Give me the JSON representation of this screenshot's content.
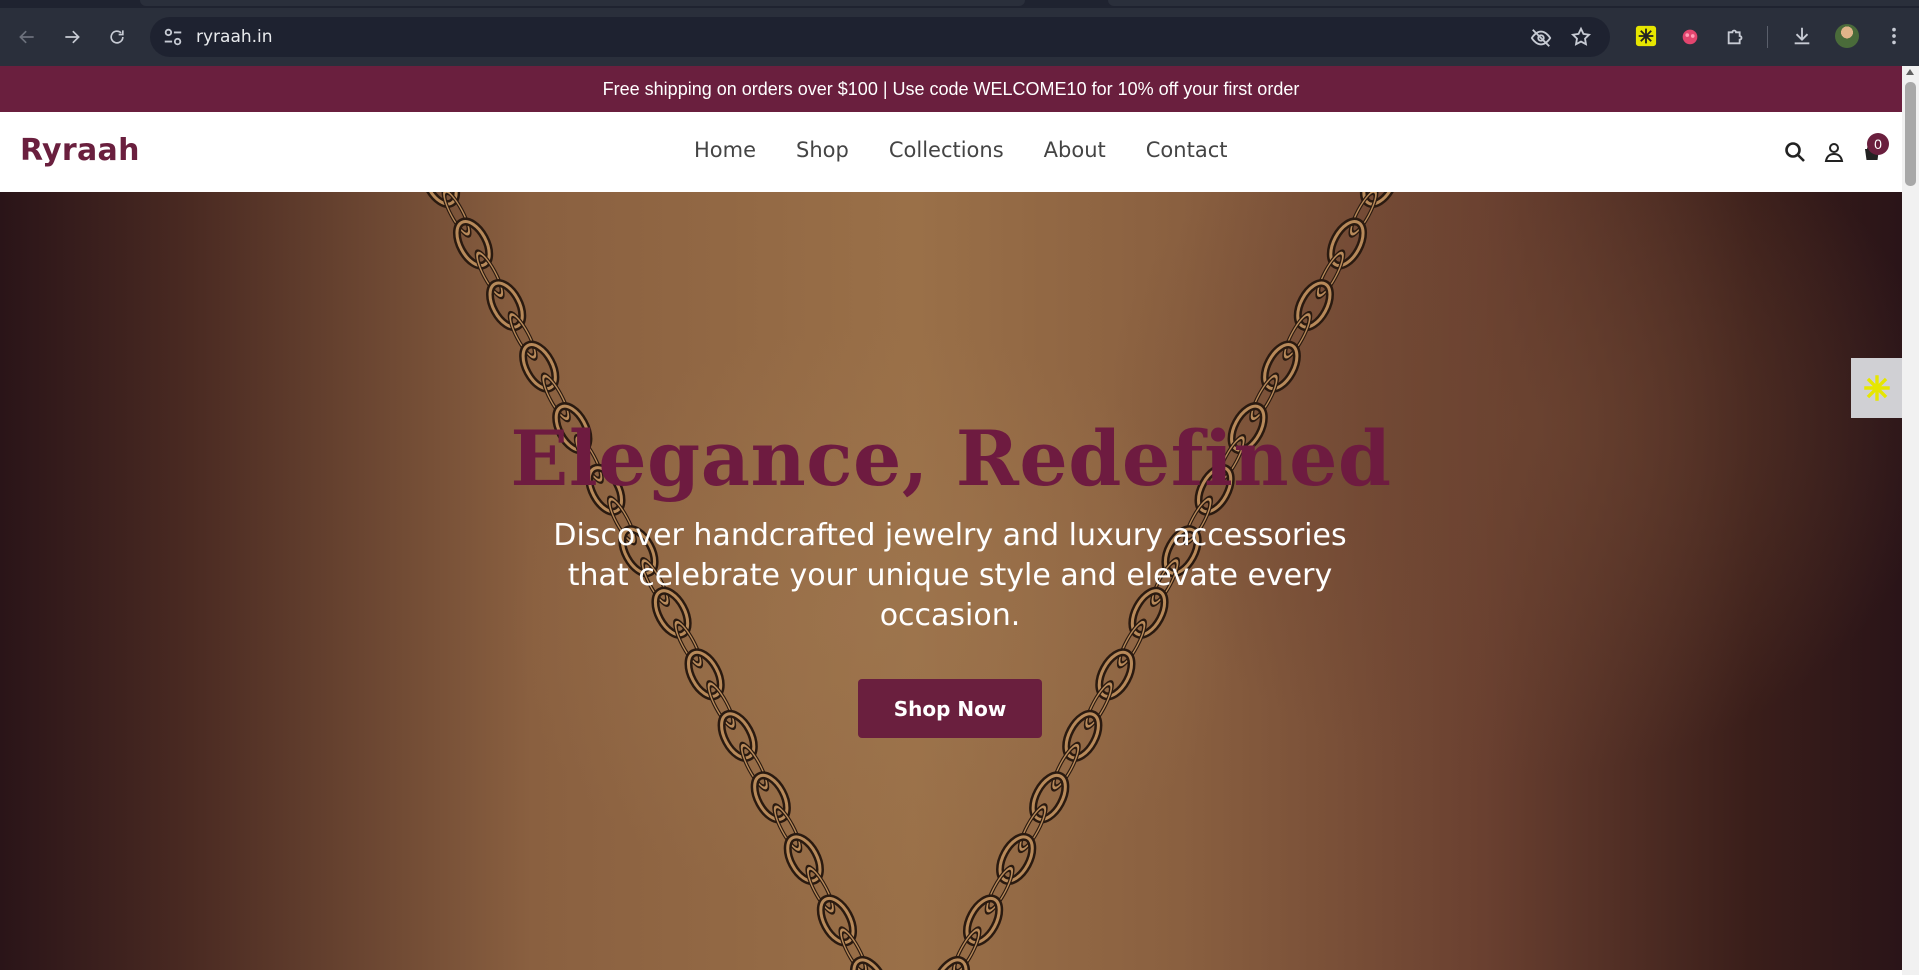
{
  "browser": {
    "url": "ryraah.in",
    "icons": {
      "back": "arrow-left-icon",
      "forward": "arrow-right-icon",
      "reload": "reload-icon",
      "site_info": "tune-icon",
      "eye_off": "eye-off-icon",
      "bookmark": "star-icon",
      "extensions": "puzzle-icon",
      "downloads": "download-icon",
      "menu": "kebab-menu-icon"
    }
  },
  "announcement": {
    "text": "Free shipping on orders over $100 | Use code WELCOME10 for 10% off your first order"
  },
  "header": {
    "logo": "Ryraah",
    "nav": [
      "Home",
      "Shop",
      "Collections",
      "About",
      "Contact"
    ],
    "cart_count": "0"
  },
  "hero": {
    "title": "Elegance, Redefined",
    "subtitle": "Discover handcrafted jewelry and luxury accessories that celebrate your unique style and elevate every occasion.",
    "cta": "Shop Now"
  },
  "colors": {
    "brand": "#6a1f3e",
    "announcement_bg": "#6a1f3e",
    "chrome_bg": "#2a2f3b",
    "omnibox_bg": "#1e2230"
  }
}
